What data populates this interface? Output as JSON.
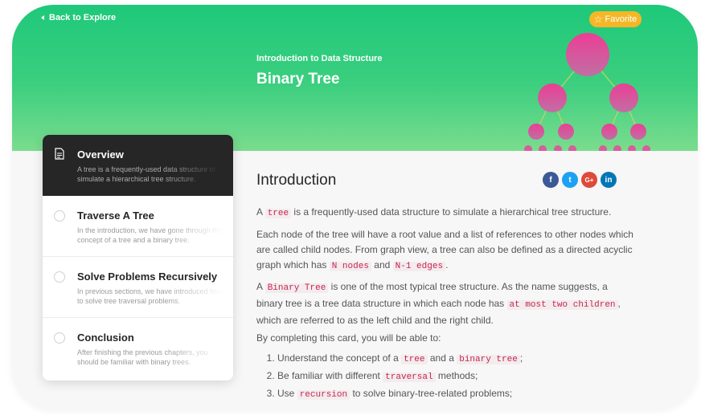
{
  "nav": {
    "back_label": "Back to Explore",
    "favorite_label": "Favorite"
  },
  "header": {
    "subtitle": "Introduction to Data Structure",
    "title": "Binary Tree"
  },
  "sidebar": {
    "items": [
      {
        "title": "Overview",
        "desc": "A tree is a frequently-used data structure to simulate a hierarchical tree structure.",
        "active": true
      },
      {
        "title": "Traverse A Tree",
        "desc": "In the introduction, we have gone through the concept of a tree and a binary tree."
      },
      {
        "title": "Solve Problems Recursively",
        "desc": "In previous sections, we have introduced how to solve tree traversal problems."
      },
      {
        "title": "Conclusion",
        "desc": "After finishing the previous chapters, you should be familiar with binary trees."
      }
    ]
  },
  "share": {
    "facebook": "f",
    "twitter": "t",
    "googleplus": "G+",
    "linkedin": "in"
  },
  "content": {
    "heading": "Introduction",
    "p1": {
      "a": "A ",
      "code": "tree",
      "b": " is a frequently-used data structure to simulate a hierarchical tree structure."
    },
    "p2": {
      "a": "Each node of the tree will have a root value and a list of references to other nodes which are called child nodes. From graph view, a tree can also be defined as a directed acyclic graph which has ",
      "code1": "N nodes",
      "b": " and ",
      "code2": "N-1 edges",
      "c": "."
    },
    "p3": {
      "a": "A ",
      "code1": "Binary Tree",
      "b": " is one of the most typical tree structure. As the name suggests, a binary tree is a tree data structure in which each node has ",
      "code2": "at most two children",
      "c": ", which are referred to as the left child and the right child."
    },
    "p4": "By completing this card, you will be able to:",
    "list": [
      {
        "a": "Understand the concept of a ",
        "code1": "tree",
        "b": " and a ",
        "code2": "binary tree",
        "c": ";"
      },
      {
        "a": "Be familiar with different ",
        "code1": "traversal",
        "b": " methods;"
      },
      {
        "a": "Use ",
        "code1": "recursion",
        "b": " to solve binary-tree-related problems;"
      }
    ]
  },
  "colors": {
    "header_green": "#1ec87a",
    "favorite": "#f5b727",
    "code": "#c7254e",
    "node_pink": "#e83e8c",
    "active_item": "#262626"
  },
  "icons": [
    "chevron-left-icon",
    "star-icon",
    "document-icon",
    "circle-icon",
    "facebook-icon",
    "twitter-icon",
    "google-plus-icon",
    "linkedin-icon"
  ]
}
